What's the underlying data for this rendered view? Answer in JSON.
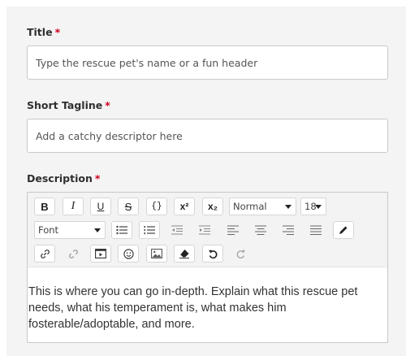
{
  "form": {
    "title": {
      "label": "Title",
      "required_mark": "*",
      "placeholder": "Type the rescue pet's name or a fun header"
    },
    "tagline": {
      "label": "Short Tagline",
      "required_mark": "*",
      "placeholder": "Add a catchy descriptor here"
    },
    "description": {
      "label": "Description",
      "required_mark": "*",
      "body": "This is where you can go in-depth. Explain what this rescue pet needs, what his temperament is, what makes him fosterable/adoptable, and more."
    }
  },
  "toolbar": {
    "bold": "B",
    "italic": "I",
    "underline": "U",
    "strikethrough": "S",
    "code": "{}",
    "superscript": "x²",
    "subscript": "x₂",
    "format_select": "Normal",
    "size_select": "18",
    "font_select": "Font"
  },
  "colors": {
    "required": "#d0021b",
    "panel_bg": "#f4f4f4",
    "border": "#c9c9c9"
  }
}
